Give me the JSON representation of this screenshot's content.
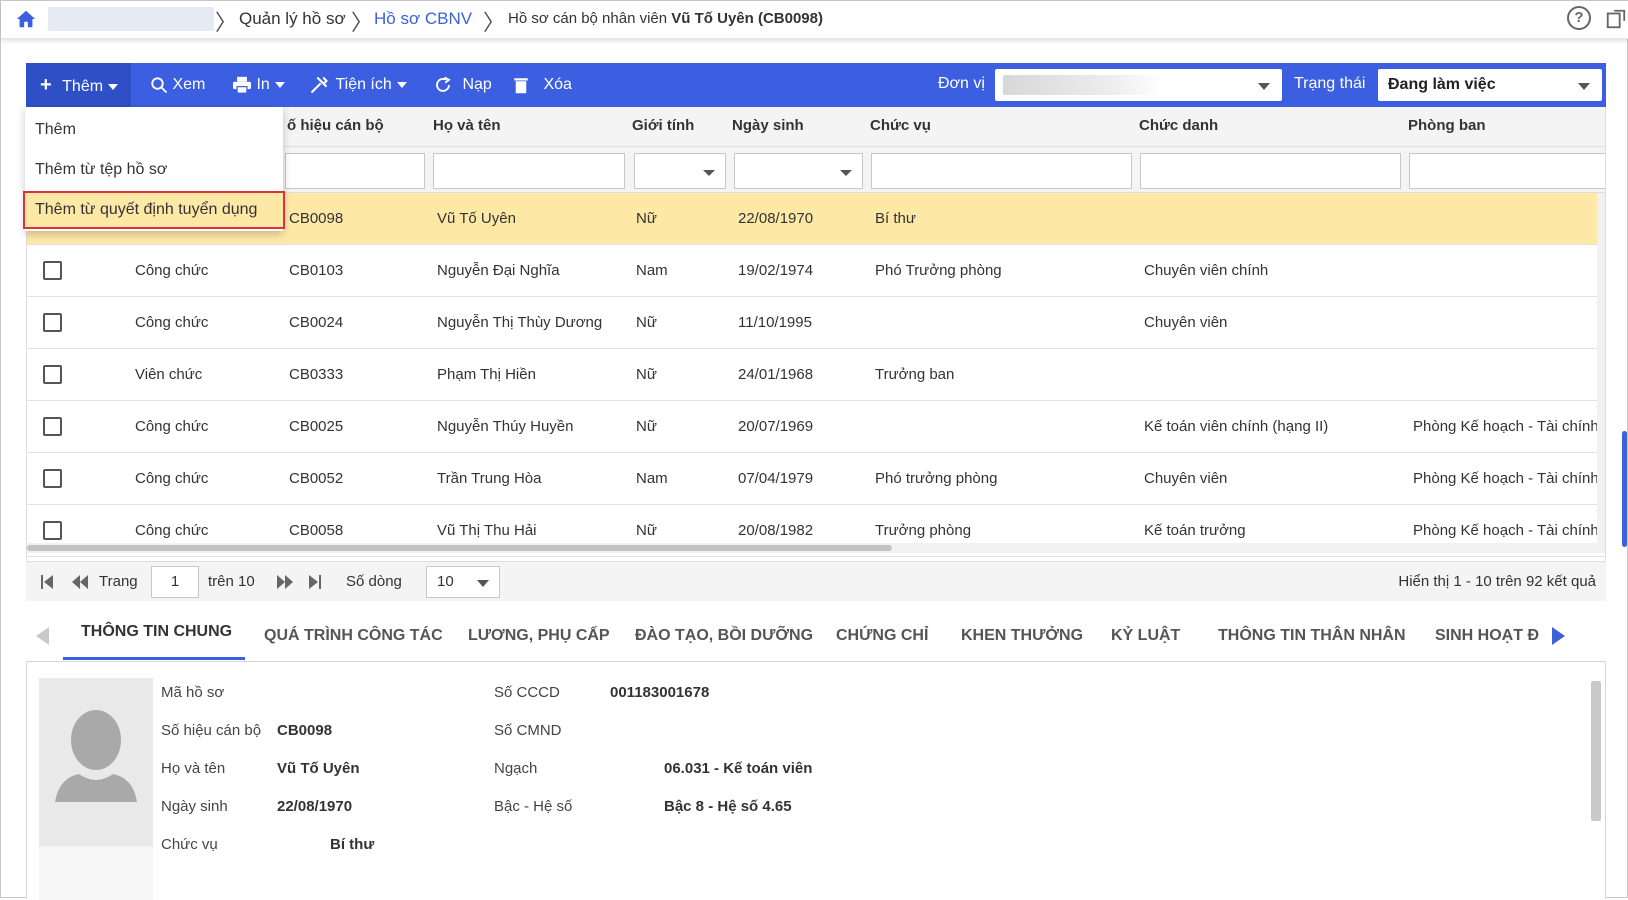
{
  "breadcrumb": {
    "level1": "Quản lý hồ sơ",
    "level2": "Hồ sơ CBNV",
    "current_prefix": "Hồ sơ cán bộ nhân viên ",
    "current_name": "Vũ Tố Uyên (CB0098)"
  },
  "icons": {
    "home": "home-icon",
    "help": "help-icon",
    "popout": "popout-icon"
  },
  "help_glyph": "?",
  "toolbar": {
    "add_label": "Thêm",
    "view_label": "Xem",
    "print_label": "In",
    "utility_label": "Tiện ích",
    "reload_label": "Nạp",
    "delete_label": "Xóa",
    "unit_label": "Đơn vị",
    "status_label": "Trạng thái",
    "status_value": "Đang làm việc"
  },
  "add_menu": {
    "items": [
      "Thêm",
      "Thêm từ tệp hồ sơ",
      "Thêm từ quyết định tuyển dụng"
    ]
  },
  "table": {
    "headers": {
      "code": "ố hiệu cán bộ",
      "name": "Họ và tên",
      "gender": "Giới tính",
      "dob": "Ngày sinh",
      "position": "Chức vụ",
      "title": "Chức danh",
      "department": "Phòng ban"
    },
    "rows": [
      {
        "type": "",
        "code": "CB0098",
        "name": "Vũ Tố Uyên",
        "gender": "Nữ",
        "dob": "22/08/1970",
        "position": "Bí thư",
        "title": "",
        "department": ""
      },
      {
        "type": "Công chức",
        "code": "CB0103",
        "name": "Nguyễn Đại Nghĩa",
        "gender": "Nam",
        "dob": "19/02/1974",
        "position": "Phó Trưởng phòng",
        "title": "Chuyên viên chính",
        "department": ""
      },
      {
        "type": "Công chức",
        "code": "CB0024",
        "name": "Nguyễn Thị Thùy Dương",
        "gender": "Nữ",
        "dob": "11/10/1995",
        "position": "",
        "title": "Chuyên viên",
        "department": ""
      },
      {
        "type": "Viên chức",
        "code": "CB0333",
        "name": "Phạm Thị Hiền",
        "gender": "Nữ",
        "dob": "24/01/1968",
        "position": "Trưởng ban",
        "title": "",
        "department": ""
      },
      {
        "type": "Công chức",
        "code": "CB0025",
        "name": "Nguyễn Thúy Huyền",
        "gender": "Nữ",
        "dob": "20/07/1969",
        "position": "",
        "title": "Kế toán viên chính (hạng II)",
        "department": "Phòng Kế hoạch - Tài chính"
      },
      {
        "type": "Công chức",
        "code": "CB0052",
        "name": "Trần Trung Hòa",
        "gender": "Nam",
        "dob": "07/04/1979",
        "position": "Phó trưởng phòng",
        "title": "Chuyên viên",
        "department": "Phòng Kế hoạch - Tài chính"
      },
      {
        "type": "Công chức",
        "code": "CB0058",
        "name": "Vũ Thị Thu Hải",
        "gender": "Nữ",
        "dob": "20/08/1982",
        "position": "Trưởng phòng",
        "title": "Kế toán trưởng",
        "department": "Phòng Kế hoạch - Tài chính"
      }
    ]
  },
  "pager": {
    "page_label": "Trang",
    "page_value": "1",
    "of_label": "trên 10",
    "rows_label": "Số dòng",
    "rows_value": "10",
    "summary": "Hiển thị 1 - 10 trên 92 kết quả"
  },
  "tabs": [
    "THÔNG TIN CHUNG",
    "QUÁ TRÌNH CÔNG TÁC",
    "LƯƠNG, PHỤ CẤP",
    "ĐÀO TẠO, BỒI DƯỠNG",
    "CHỨNG CHỈ",
    "KHEN THƯỞNG",
    "KỶ LUẬT",
    "THÔNG TIN THÂN NHÂN",
    "SINH HOẠT Đ"
  ],
  "more_dots": "•••",
  "detail": {
    "record_label": "Mã hồ sơ",
    "record_value": "",
    "code_label": "Số hiệu cán bộ",
    "code_value": "CB0098",
    "name_label": "Họ và tên",
    "name_value": "Vũ Tố Uyên",
    "dob_label": "Ngày sinh",
    "dob_value": "22/08/1970",
    "position_label": "Chức vụ",
    "position_value": "Bí thư",
    "cccd_label": "Số CCCD",
    "cccd_value": "001183001678",
    "cmnd_label": "Số CMND",
    "cmnd_value": "",
    "grade_label": "Ngạch",
    "grade_value": "06.031 - Kế toán viên",
    "level_label": "Bậc - Hệ số",
    "level_value": "Bậc 8 - Hệ số 4.65"
  },
  "colors": {
    "toolbar": "#3b5fe0",
    "link": "#3b63d8",
    "selected_row": "#fde8a6",
    "highlight_border": "#e0303a"
  }
}
